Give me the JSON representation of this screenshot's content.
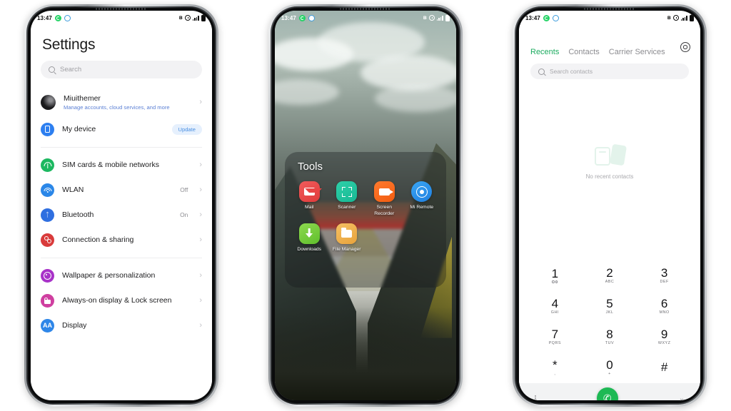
{
  "statusbar": {
    "time": "13:47",
    "icons_left": [
      "whatsapp-icon",
      "message-icon"
    ],
    "icons_right": [
      "bluetooth-icon",
      "alarm-icon",
      "signal-icon",
      "battery-icon"
    ],
    "bluetooth_glyph": "ʙ"
  },
  "settings": {
    "title": "Settings",
    "search_placeholder": "Search",
    "account": {
      "name": "Miuithemer",
      "subtitle": "Manage accounts, cloud services, and more"
    },
    "rows": [
      {
        "label": "My device",
        "badge": "Update",
        "icon": "device-icon"
      },
      {
        "label": "SIM cards & mobile networks",
        "value": "",
        "icon": "sim-icon"
      },
      {
        "label": "WLAN",
        "value": "Off",
        "icon": "wifi-icon"
      },
      {
        "label": "Bluetooth",
        "value": "On",
        "icon": "bluetooth-icon"
      },
      {
        "label": "Connection & sharing",
        "value": "",
        "icon": "connection-icon"
      },
      {
        "label": "Wallpaper & personalization",
        "value": "",
        "icon": "wallpaper-icon"
      },
      {
        "label": "Always-on display & Lock screen",
        "value": "",
        "icon": "lock-icon"
      },
      {
        "label": "Display",
        "value": "",
        "icon": "display-icon"
      }
    ],
    "chevron": "›"
  },
  "home": {
    "folder_title": "Tools",
    "apps": [
      {
        "name": "Mail",
        "icon": "mail-icon"
      },
      {
        "name": "Scanner",
        "icon": "scanner-icon"
      },
      {
        "name": "Screen Recorder",
        "icon": "screen-recorder-icon"
      },
      {
        "name": "Mi Remote",
        "icon": "mi-remote-icon"
      },
      {
        "name": "Downloads",
        "icon": "downloads-icon"
      },
      {
        "name": "File Manager",
        "icon": "file-manager-icon"
      }
    ]
  },
  "dialer": {
    "tabs": [
      {
        "label": "Recents",
        "active": true
      },
      {
        "label": "Contacts",
        "active": false
      },
      {
        "label": "Carrier Services",
        "active": false
      }
    ],
    "search_placeholder": "Search contacts",
    "empty_text": "No recent contacts",
    "keys": [
      {
        "digit": "1",
        "letters": ""
      },
      {
        "digit": "2",
        "letters": "ABC"
      },
      {
        "digit": "3",
        "letters": "DEF"
      },
      {
        "digit": "4",
        "letters": "GHI"
      },
      {
        "digit": "5",
        "letters": "JKL"
      },
      {
        "digit": "6",
        "letters": "MNO"
      },
      {
        "digit": "7",
        "letters": "PQRS"
      },
      {
        "digit": "8",
        "letters": "TUV"
      },
      {
        "digit": "9",
        "letters": "WXYZ"
      },
      {
        "digit": "*",
        "letters": ","
      },
      {
        "digit": "0",
        "letters": "+"
      },
      {
        "digit": "#",
        "letters": ""
      }
    ],
    "call_glyph": "✆",
    "chevron_down": "⌄"
  },
  "colors": {
    "accent_green": "#1bab5f",
    "call_green": "#1db954",
    "link_blue": "#5a7fd4",
    "badge_blue": "#4a90e2"
  }
}
